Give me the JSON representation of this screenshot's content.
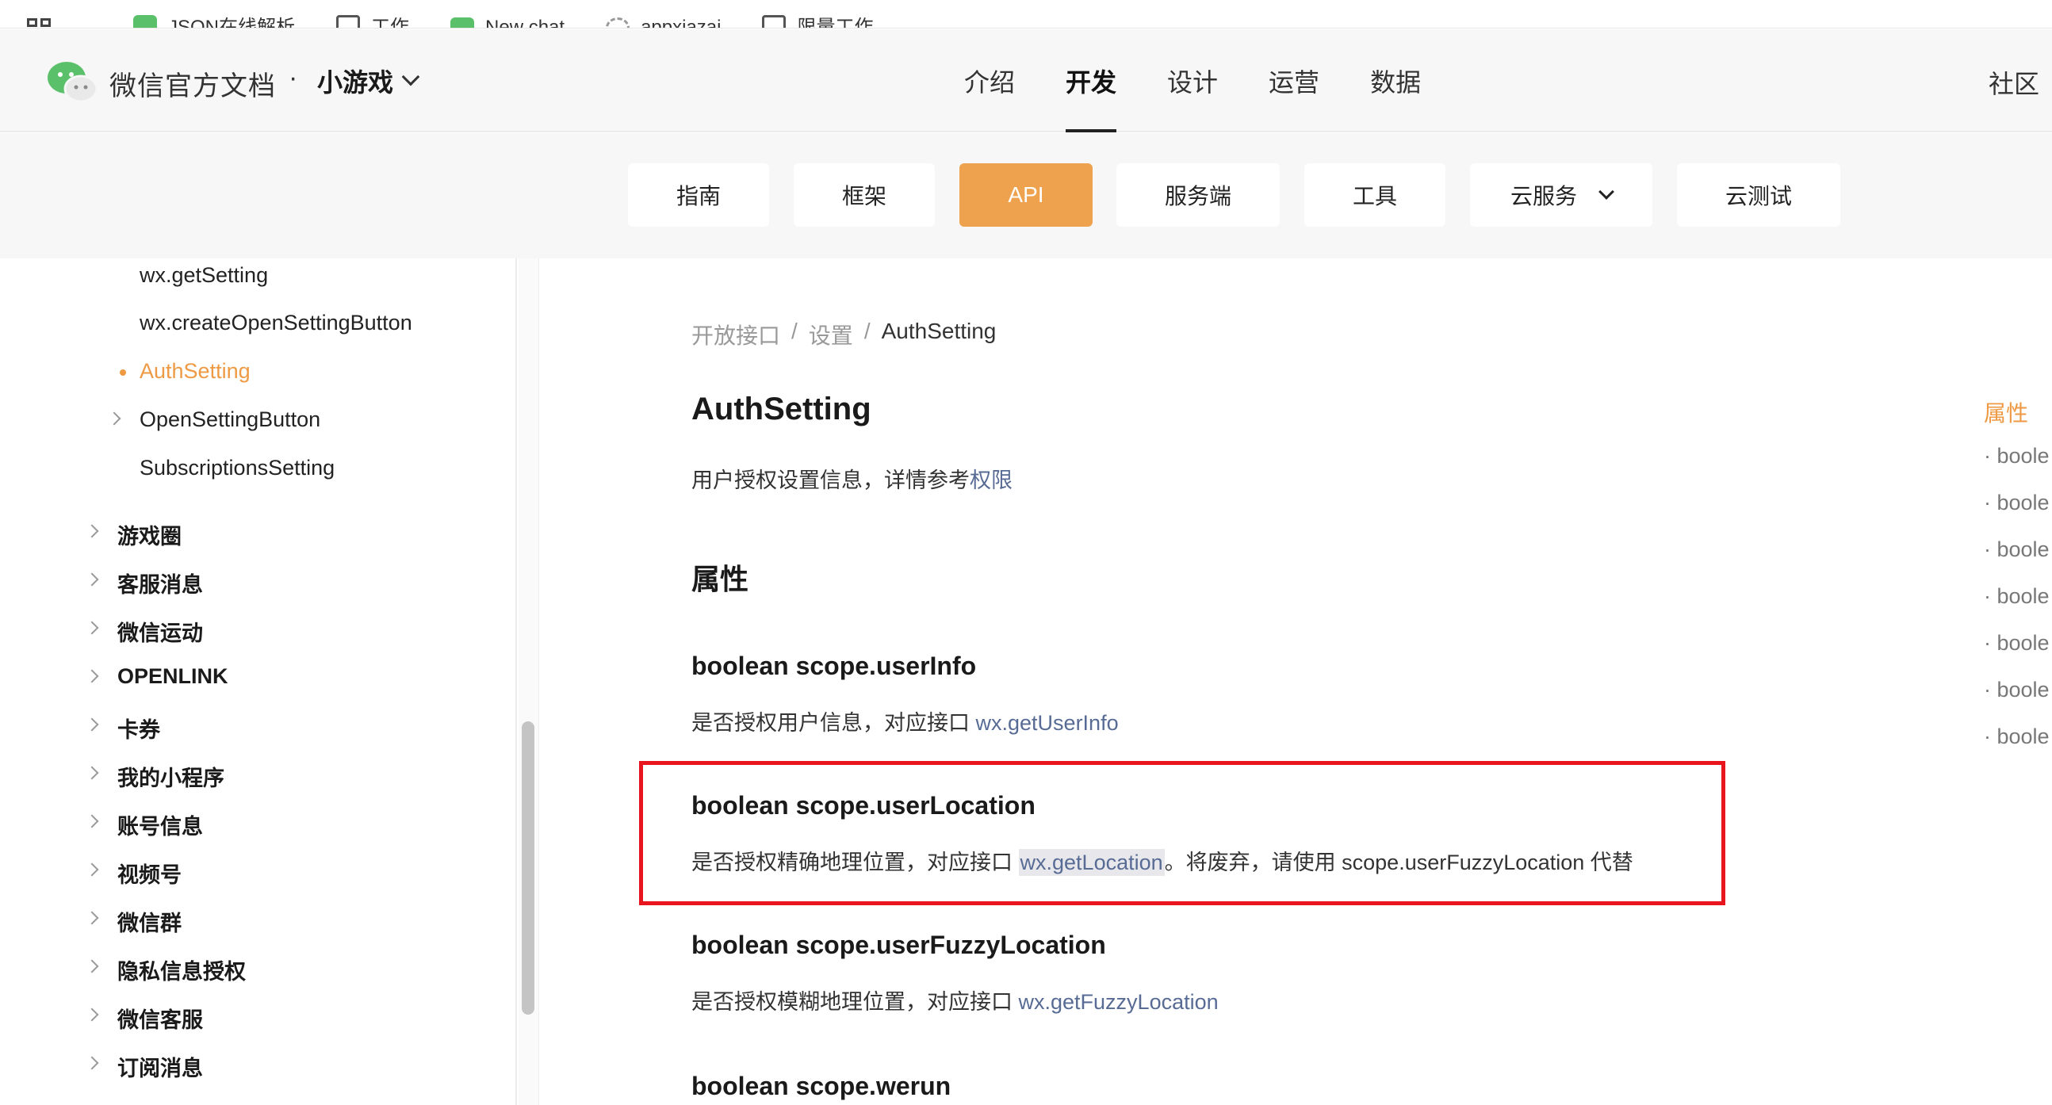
{
  "bookmarks": [
    {
      "label": "JSON在线解析",
      "icon": "json-icon"
    },
    {
      "label": "工作",
      "icon": "folder-icon"
    },
    {
      "label": "New chat",
      "icon": "chat-icon"
    },
    {
      "label": "appxiazai",
      "icon": "gear-icon"
    },
    {
      "label": "限量工作",
      "icon": "folder-icon"
    }
  ],
  "header": {
    "brand": "微信官方文档",
    "dot": "·",
    "product": "小游戏",
    "tabs": [
      "介绍",
      "开发",
      "设计",
      "运营",
      "数据"
    ],
    "active_tab": "开发",
    "community": "社区"
  },
  "subnav": {
    "items": [
      "指南",
      "框架",
      "API",
      "服务端",
      "工具",
      "云服务",
      "云测试"
    ],
    "active": "API"
  },
  "sidebar": {
    "sub_items": [
      "wx.getSetting",
      "wx.createOpenSettingButton",
      "AuthSetting",
      "OpenSettingButton",
      "SubscriptionsSetting"
    ],
    "active": "AuthSetting",
    "top_items": [
      "游戏圈",
      "客服消息",
      "微信运动",
      "OPENLINK",
      "卡券",
      "我的小程序",
      "账号信息",
      "视频号",
      "微信群",
      "隐私信息授权",
      "微信客服",
      "订阅消息"
    ]
  },
  "main": {
    "breadcrumb": [
      "开放接口",
      "设置",
      "AuthSetting"
    ],
    "breadcrumb_sep": "/",
    "title": "AuthSetting",
    "desc_prefix": "用户授权设置信息，详情参考",
    "desc_link": "权限",
    "section": "属性",
    "props": [
      {
        "name": "boolean scope.userInfo",
        "desc": "是否授权用户信息，对应接口 ",
        "link": "wx.getUserInfo",
        "suffix": ""
      },
      {
        "name": "boolean scope.userLocation",
        "desc": "是否授权精确地理位置，对应接口 ",
        "link": "wx.getLocation",
        "suffix": "。将废弃，请使用 scope.userFuzzyLocation 代替"
      },
      {
        "name": "boolean scope.userFuzzyLocation",
        "desc": "是否授权模糊地理位置，对应接口 ",
        "link": "wx.getFuzzyLocation",
        "suffix": ""
      },
      {
        "name": "boolean scope.werun",
        "desc": "",
        "link": "",
        "suffix": ""
      }
    ]
  },
  "toc": {
    "title": "属性",
    "items": [
      "· boole",
      "· boole",
      "· boole",
      "· boole",
      "· boole",
      "· boole",
      "· boole"
    ]
  },
  "colors": {
    "accent": "#eea24e",
    "link": "#576b95",
    "highlight_box": "#e8141e"
  }
}
